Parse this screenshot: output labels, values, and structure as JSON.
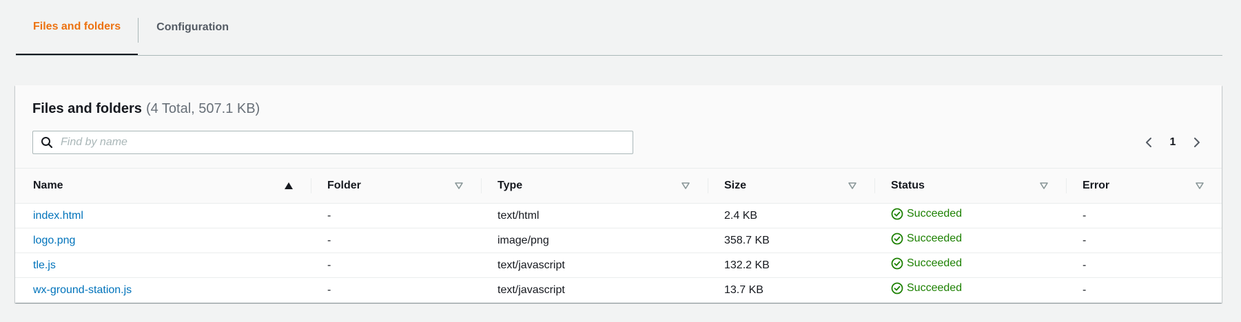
{
  "tabs": [
    {
      "label": "Files and folders",
      "active": true
    },
    {
      "label": "Configuration",
      "active": false
    }
  ],
  "panel": {
    "title": "Files and folders",
    "counter": "(4 Total, 507.1 KB)"
  },
  "search": {
    "placeholder": "Find by name",
    "value": ""
  },
  "pagination": {
    "current_page": "1"
  },
  "table": {
    "columns": [
      "Name",
      "Folder",
      "Type",
      "Size",
      "Status",
      "Error"
    ],
    "rows": [
      {
        "name": "index.html",
        "folder": "-",
        "type": "text/html",
        "size": "2.4 KB",
        "status": "Succeeded",
        "error": "-"
      },
      {
        "name": "logo.png",
        "folder": "-",
        "type": "image/png",
        "size": "358.7 KB",
        "status": "Succeeded",
        "error": "-"
      },
      {
        "name": "tle.js",
        "folder": "-",
        "type": "text/javascript",
        "size": "132.2 KB",
        "status": "Succeeded",
        "error": "-"
      },
      {
        "name": "wx-ground-station.js",
        "folder": "-",
        "type": "text/javascript",
        "size": "13.7 KB",
        "status": "Succeeded",
        "error": "-"
      }
    ]
  },
  "colors": {
    "accent": "#ec7211",
    "link": "#0073bb",
    "success": "#1d8102"
  },
  "icons": {
    "search": "search-icon",
    "prev": "chevron-left-icon",
    "next": "chevron-right-icon",
    "sort_asc": "sort-ascending-icon",
    "sort": "sort-icon",
    "status": "check-circle-icon"
  }
}
